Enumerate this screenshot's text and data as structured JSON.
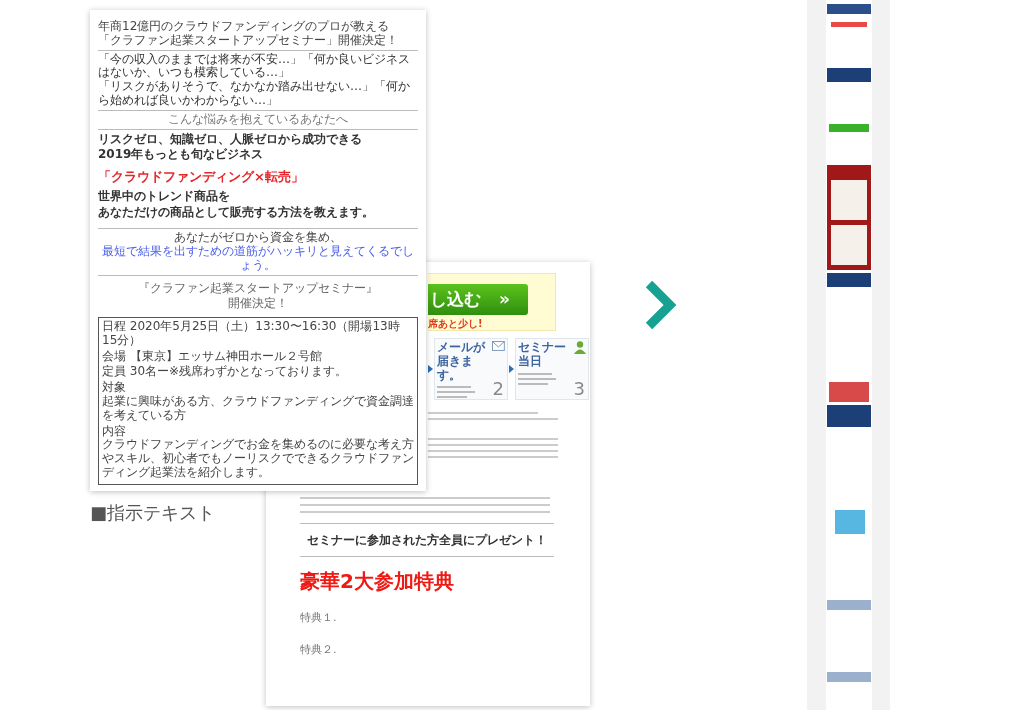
{
  "left_document": {
    "intro": [
      "年商12億円のクラウドファンディングのプロが教える",
      "「クラファン起業スタートアップセミナー」開催決定！"
    ],
    "worries": [
      "「今の収入のままでは将来が不安…」「何か良いビジネスはないか、いつも模索している…」",
      "「リスクがありそうで、なかなか踏み出せない…」「何から始めれば良いかわからない…」"
    ],
    "worries_caption": "こんな悩みを抱えているあなたへ",
    "headline": [
      "リスクゼロ、知識ゼロ、人脈ゼロから成功できる",
      "2019年もっとも旬なビジネス"
    ],
    "highlight": "「クラウドファンディング×転売」",
    "pitch": [
      "世界中のトレンド商品を",
      "あなただけの商品として販売する方法を教えます。"
    ],
    "closing": "あなたがゼロから資金を集め、",
    "closing_link": "最短で結果を出すための道筋がハッキリと見えてくるでしょう。",
    "seminar_title": [
      "『クラファン起業スタートアップセミナー』",
      "開催決定！"
    ],
    "details": [
      [
        "日程 2020年5月25日（土）13:30〜16:30（開場13時15分）"
      ],
      [
        "会場 【東京】エッサム神田ホール２号館"
      ],
      [
        "定員 30名ー※残席わずかとなっております。"
      ],
      [
        "対象",
        "起業に興味がある方、クラウドファンディングで資金調達を考えている方"
      ],
      [
        "内容",
        "クラウドファンディングでお金を集めるのに必要な考え方やスキル、初心者でもノーリスクでできるクラウドファンディング起業法を紹介します。"
      ]
    ]
  },
  "caption": "■指示テキスト",
  "middle_document": {
    "apply_button": "し込む",
    "apply_arrow": "»",
    "urgency_note": "席あと少し!",
    "steps": [
      {
        "title": "メールが届きます。",
        "number": "2",
        "kind": "mail"
      },
      {
        "title": "セミナー当日",
        "number": "3",
        "kind": "person"
      }
    ],
    "gift_heading": "セミナーに参加された方全員にプレゼント！",
    "gift_title": "豪華2大参加特典",
    "gifts": [
      "特典１.",
      "特典２."
    ]
  }
}
